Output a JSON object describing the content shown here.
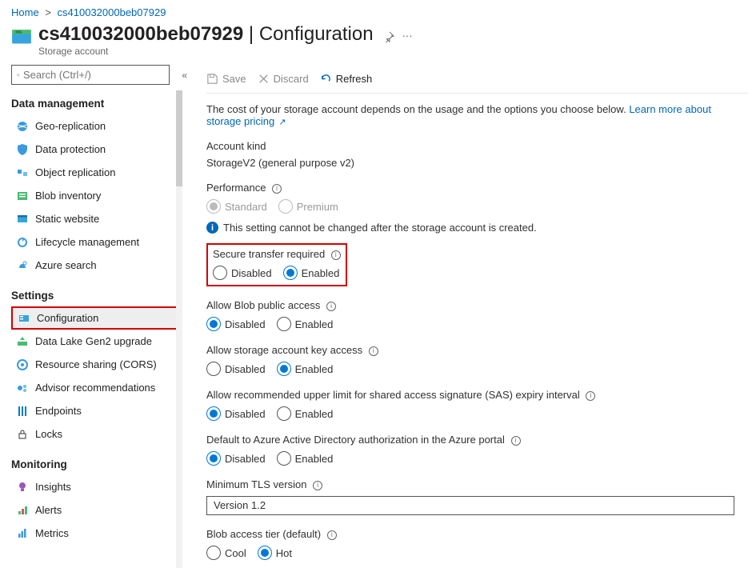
{
  "breadcrumbs": {
    "home": "Home",
    "resource": "cs410032000beb07929"
  },
  "header": {
    "title_name": "cs410032000beb07929",
    "title_section": "Configuration",
    "subtitle": "Storage account"
  },
  "search": {
    "placeholder": "Search (Ctrl+/)"
  },
  "sidebar": {
    "group_data": "Data management",
    "group_settings": "Settings",
    "group_monitoring": "Monitoring",
    "geo": "Geo-replication",
    "dataprot": "Data protection",
    "objrep": "Object replication",
    "blobinv": "Blob inventory",
    "static": "Static website",
    "lifecycle": "Lifecycle management",
    "azsearch": "Azure search",
    "config": "Configuration",
    "gen2": "Data Lake Gen2 upgrade",
    "cors": "Resource sharing (CORS)",
    "advisor": "Advisor recommendations",
    "endpoints": "Endpoints",
    "locks": "Locks",
    "insights": "Insights",
    "alerts": "Alerts",
    "metrics": "Metrics"
  },
  "toolbar": {
    "save": "Save",
    "discard": "Discard",
    "refresh": "Refresh"
  },
  "content": {
    "intro_text": "The cost of your storage account depends on the usage and the options you choose below. ",
    "intro_link": "Learn more about storage pricing",
    "account_kind_label": "Account kind",
    "account_kind_value": "StorageV2 (general purpose v2)",
    "performance_label": "Performance",
    "perf_standard": "Standard",
    "perf_premium": "Premium",
    "perf_note": "This setting cannot be changed after the storage account is created.",
    "secure_label": "Secure transfer required",
    "blobpublic_label": "Allow Blob public access",
    "keyaccess_label": "Allow storage account key access",
    "sasexpiry_label": "Allow recommended upper limit for shared access signature (SAS) expiry interval",
    "aadauth_label": "Default to Azure Active Directory authorization in the Azure portal",
    "tls_label": "Minimum TLS version",
    "tls_value": "Version 1.2",
    "tier_label": "Blob access tier (default)",
    "opt_disabled": "Disabled",
    "opt_enabled": "Enabled",
    "opt_cool": "Cool",
    "opt_hot": "Hot"
  }
}
